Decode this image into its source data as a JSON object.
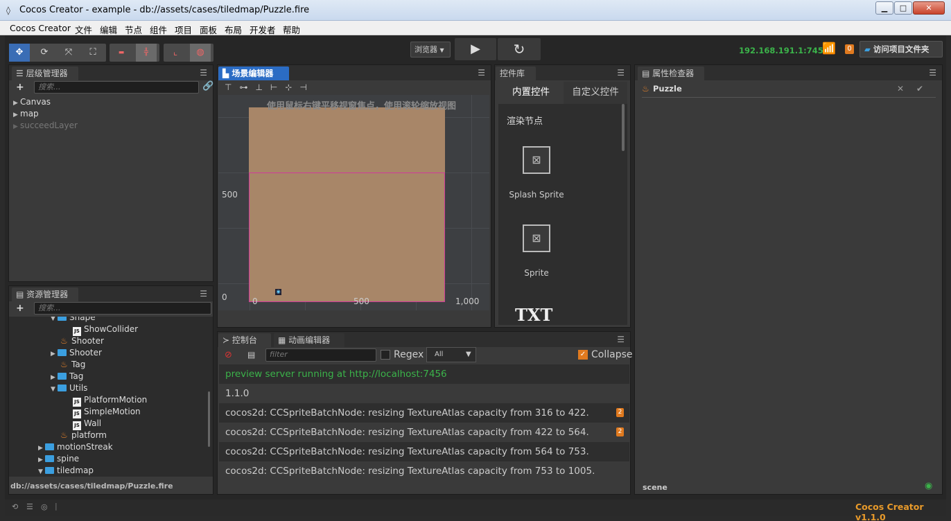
{
  "window": {
    "title": "Cocos Creator - example - db://assets/cases/tiledmap/Puzzle.fire",
    "min": "▁",
    "max": "□",
    "close": "✕"
  },
  "menu": [
    "Cocos Creator",
    "文件",
    "编辑",
    "节点",
    "组件",
    "项目",
    "面板",
    "布局",
    "开发者",
    "帮助"
  ],
  "toolbar": {
    "browser": "浏览器",
    "ip": "192.168.191.1:7456",
    "notif_count": "0",
    "open_folder": "访问项目文件夹"
  },
  "hierarchy": {
    "title": "层级管理器",
    "search_placeholder": "搜索...",
    "nodes": [
      "Canvas",
      "map",
      "succeedLayer"
    ]
  },
  "assets": {
    "title": "资源管理器",
    "search_placeholder": "搜索...",
    "items": [
      "Shape",
      "ShowCollider",
      "Shooter",
      "Shooter",
      "Tag",
      "Tag",
      "Utils",
      "PlatformMotion",
      "SimpleMotion",
      "Wall",
      "platform",
      "motionStreak",
      "spine",
      "tiledmap"
    ],
    "path": "db://assets/cases/tiledmap/Puzzle.fire"
  },
  "scene": {
    "title": "场景编辑器",
    "hint": "使用鼠标右键平移视窗焦点，使用滚轮缩放视图",
    "y_labels": [
      "500",
      "0"
    ],
    "x_labels": [
      "0",
      "500",
      "1,000"
    ]
  },
  "widgets": {
    "title": "控件库",
    "tab_builtin": "内置控件",
    "tab_custom": "自定义控件",
    "section": "渲染节点",
    "items": [
      "Splash Sprite",
      "Sprite"
    ],
    "txt": "TXT"
  },
  "inspector": {
    "title": "属性检查器",
    "node": "Puzzle",
    "footer": "scene"
  },
  "console": {
    "tab_console": "控制台",
    "tab_anim": "动画编辑器",
    "filter_placeholder": "filter",
    "regex": "Regex",
    "level": "All",
    "collapse": "Collapse",
    "lines": [
      {
        "text": "preview server running at http://localhost:7456",
        "color": "#3bb34a",
        "badge": ""
      },
      {
        "text": "1.1.0",
        "color": "#cccccc",
        "badge": ""
      },
      {
        "text": "cocos2d: CCSpriteBatchNode: resizing TextureAtlas capacity from 316 to 422.",
        "color": "#cccccc",
        "badge": "2"
      },
      {
        "text": "cocos2d: CCSpriteBatchNode: resizing TextureAtlas capacity from 422 to 564.",
        "color": "#cccccc",
        "badge": "2"
      },
      {
        "text": "cocos2d: CCSpriteBatchNode: resizing TextureAtlas capacity from 564 to 753.",
        "color": "#cccccc",
        "badge": ""
      },
      {
        "text": "cocos2d: CCSpriteBatchNode: resizing TextureAtlas capacity from 753 to 1005.",
        "color": "#cccccc",
        "badge": ""
      }
    ]
  },
  "status": {
    "version": "Cocos Creator v1.1.0"
  },
  "colors": {
    "accent": "#2b6cc4",
    "green": "#3bb34a",
    "orange": "#e07a1f"
  }
}
